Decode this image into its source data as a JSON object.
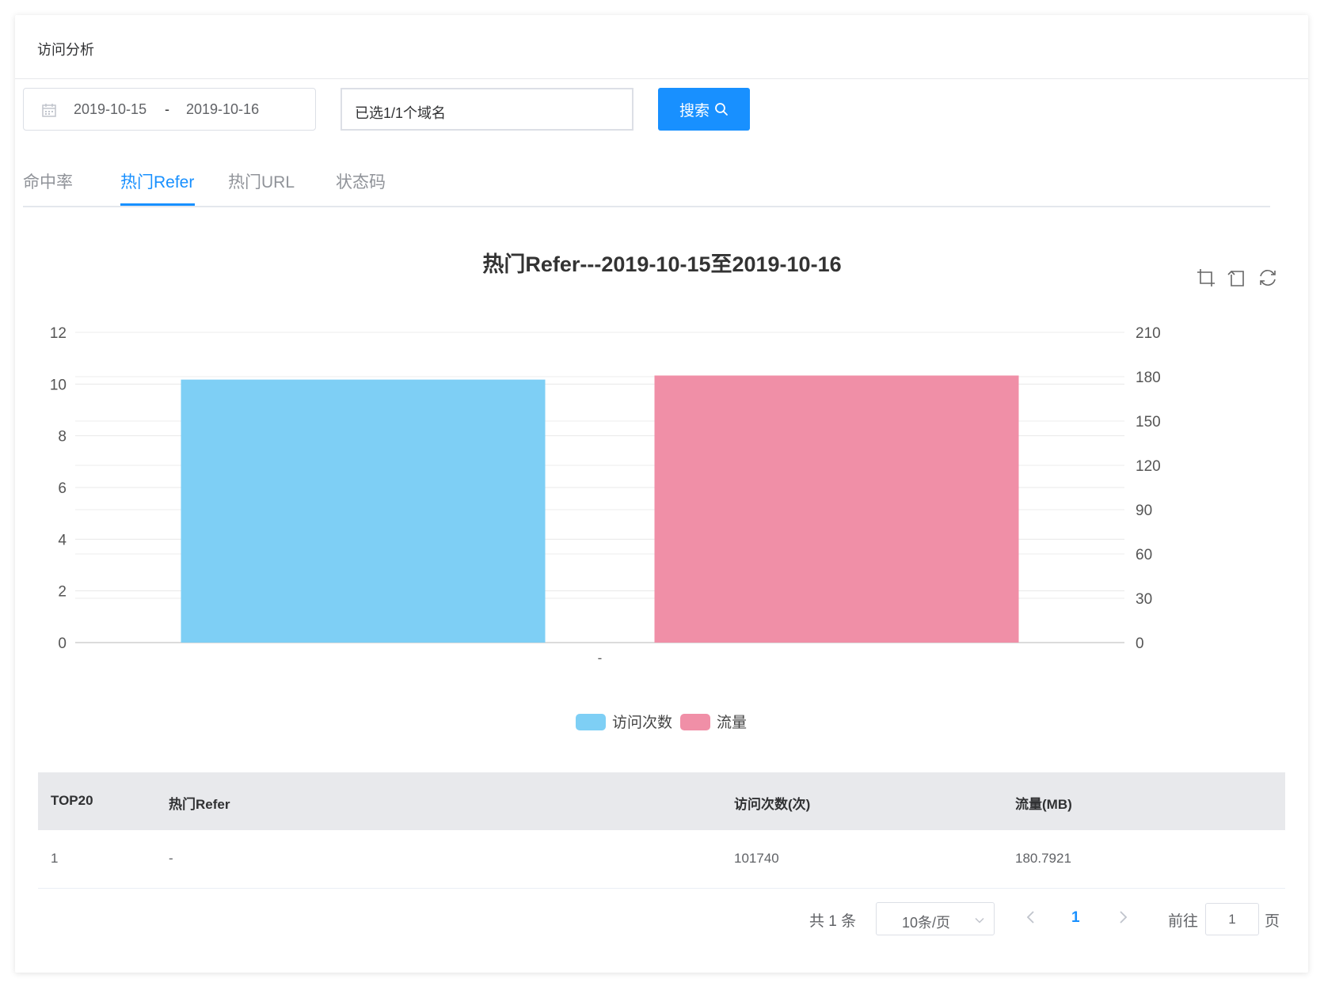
{
  "header": {
    "title": "访问分析"
  },
  "filters": {
    "date_start": "2019-10-15",
    "date_separator": "-",
    "date_end": "2019-10-16",
    "domain_text": "已选1/1个域名",
    "search_label": "搜索"
  },
  "tabs": [
    {
      "label": "命中率",
      "active": false
    },
    {
      "label": "热门Refer",
      "active": true
    },
    {
      "label": "热门URL",
      "active": false
    },
    {
      "label": "状态码",
      "active": false
    }
  ],
  "chart_data": {
    "type": "bar",
    "title": "热门Refer---2019-10-15至2019-10-16",
    "categories": [
      "-"
    ],
    "series": [
      {
        "name": "访问次数",
        "color": "#7ecff5",
        "axis": "left",
        "values": [
          10.174
        ]
      },
      {
        "name": "流量",
        "color": "#f08fa7",
        "axis": "right",
        "values": [
          180.7921
        ]
      }
    ],
    "y_left": {
      "min": 0,
      "max": 12,
      "ticks": [
        0,
        2,
        4,
        6,
        8,
        10,
        12
      ]
    },
    "y_right": {
      "min": 0,
      "max": 210,
      "ticks": [
        0,
        30,
        60,
        90,
        120,
        150,
        180,
        210
      ]
    },
    "grid": true,
    "legend": "bottom-center",
    "toolbox": [
      "zoom-icon",
      "zoom-reset-icon",
      "restore-icon"
    ]
  },
  "table": {
    "headers": [
      "TOP20",
      "热门Refer",
      "访问次数(次)",
      "流量(MB)"
    ],
    "rows": [
      [
        "1",
        "-",
        "101740",
        "180.7921"
      ]
    ]
  },
  "pagination": {
    "total_text": "共 1 条",
    "page_size_text": "10条/页",
    "current_page": "1",
    "goto_label": "前往",
    "goto_value": "1",
    "page_unit": "页"
  },
  "colors": {
    "accent": "#1890ff",
    "bar1": "#7ecff5",
    "bar2": "#f08fa7"
  }
}
